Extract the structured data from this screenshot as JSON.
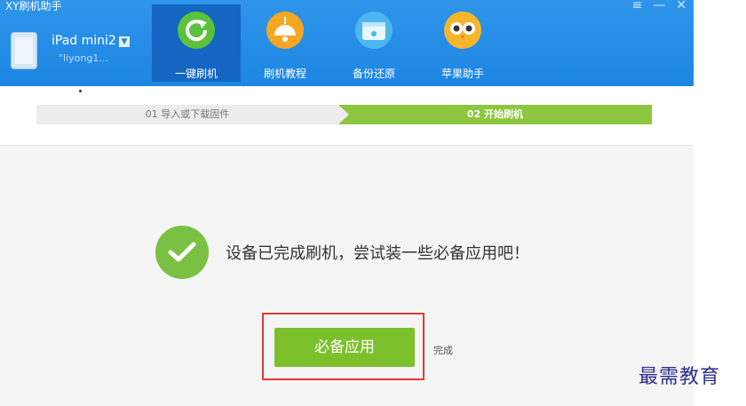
{
  "app": {
    "title": "XY刷机助手"
  },
  "window_controls": {
    "menu": "≡",
    "minimize": "—",
    "close": "✕"
  },
  "device": {
    "name": "iPad mini2",
    "dropdown": "▼",
    "sub": "\"liyong1..."
  },
  "tabs": [
    {
      "label": "一键刷机",
      "icon": "refresh-icon"
    },
    {
      "label": "刷机教程",
      "icon": "lamp-icon"
    },
    {
      "label": "备份还原",
      "icon": "disc-icon"
    },
    {
      "label": "苹果助手",
      "icon": "owl-icon"
    }
  ],
  "steps": {
    "step1": "01 导入或下载固件",
    "step2": "02 开始刷机"
  },
  "result": {
    "message": "设备已完成刷机，尝试装一些必备应用吧！"
  },
  "actions": {
    "apps_button": "必备应用",
    "done_link": "完成"
  },
  "watermark": {
    "text": "最需教育"
  },
  "colors": {
    "header": "#1d86e2",
    "accent": "#7ac143",
    "active_tab": "#1466c2",
    "highlight": "#e53935"
  }
}
